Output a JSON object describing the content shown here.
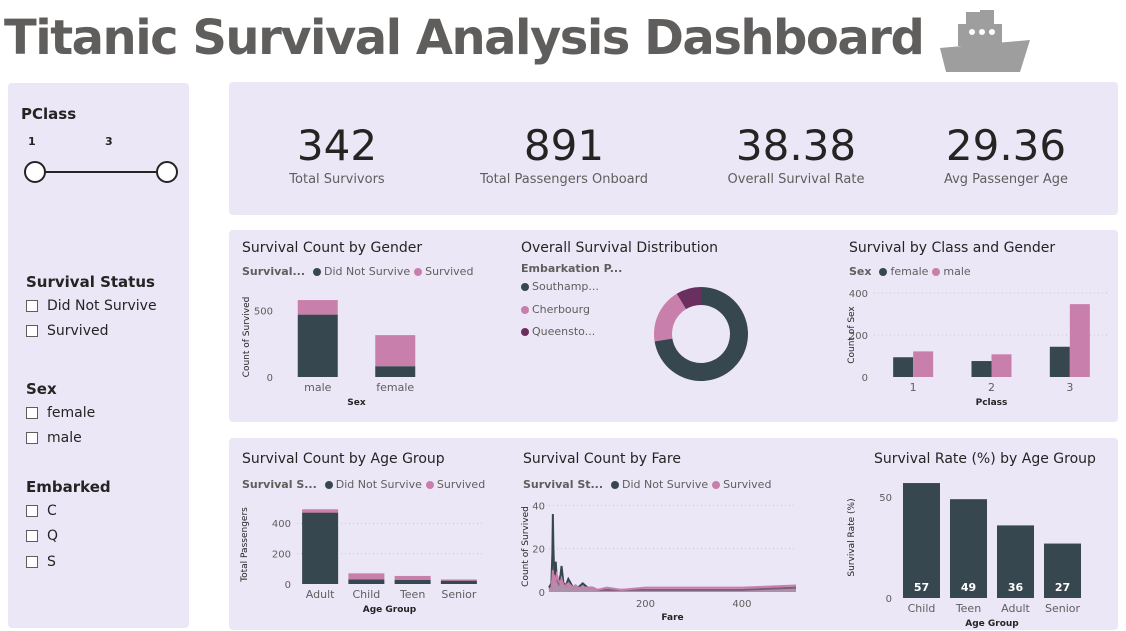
{
  "title": "Titanic Survival Analysis Dashboard",
  "colors": {
    "did_not_survive": "#37474f",
    "survived": "#c97fab",
    "queenstown": "#6b2f5f",
    "panel": "#ebe7f7"
  },
  "filters": {
    "pclass": {
      "title": "PClass",
      "min_label": "1",
      "max_label": "3"
    },
    "survival_status": {
      "title": "Survival Status",
      "options": [
        "Did Not Survive",
        "Survived"
      ]
    },
    "sex": {
      "title": "Sex",
      "options": [
        "female",
        "male"
      ]
    },
    "embarked": {
      "title": "Embarked",
      "options": [
        "C",
        "Q",
        "S"
      ]
    }
  },
  "kpis": [
    {
      "value": "342",
      "label": "Total Survivors"
    },
    {
      "value": "891",
      "label": "Total Passengers Onboard"
    },
    {
      "value": "38.38",
      "label": "Overall Survival Rate"
    },
    {
      "value": "29.36",
      "label": "Avg Passenger Age"
    }
  ],
  "charts": {
    "gender": {
      "title": "Survival Count by Gender",
      "legend_title": "Survival...",
      "legend": [
        "Did Not Survive",
        "Survived"
      ],
      "ylabel": "Count of Survived",
      "xlabel": "Sex"
    },
    "distribution": {
      "title": "Overall Survival Distribution",
      "legend_title": "Embarkation P...",
      "legend": [
        "Southamp...",
        "Cherbourg",
        "Queensto..."
      ]
    },
    "class_gender": {
      "title": "Survival by Class and Gender",
      "legend_title": "Sex",
      "legend": [
        "female",
        "male"
      ],
      "ylabel": "Count of Sex",
      "xlabel": "Pclass"
    },
    "age_group": {
      "title": "Survival Count by Age Group",
      "legend_title": "Survival S...",
      "legend": [
        "Did Not Survive",
        "Survived"
      ],
      "ylabel": "Total Passengers",
      "xlabel": "Age Group"
    },
    "fare": {
      "title": "Survival Count by Fare",
      "legend_title": "Survival St...",
      "legend": [
        "Did Not Survive",
        "Survived"
      ],
      "ylabel": "Count of Survived",
      "xlabel": "Fare"
    },
    "rate": {
      "title": "Survival Rate (%) by Age Group",
      "ylabel": "Survival Rate (%)",
      "xlabel": "Age Group"
    }
  },
  "chart_data": [
    {
      "type": "bar",
      "title": "Survival Count by Gender",
      "categories": [
        "male",
        "female"
      ],
      "series": [
        {
          "name": "Did Not Survive",
          "values": [
            468,
            81
          ]
        },
        {
          "name": "Survived",
          "values": [
            109,
            233
          ]
        }
      ],
      "xlabel": "Sex",
      "ylabel": "Count of Survived",
      "ylim": [
        0,
        600
      ],
      "yticks": [
        0,
        500
      ],
      "stacked": true
    },
    {
      "type": "pie",
      "title": "Overall Survival Distribution",
      "categories": [
        "Southamp...",
        "Cherbourg",
        "Queensto..."
      ],
      "values": [
        646,
        168,
        77
      ]
    },
    {
      "type": "bar",
      "title": "Survival by Class and Gender",
      "categories": [
        "1",
        "2",
        "3"
      ],
      "series": [
        {
          "name": "female",
          "values": [
            94,
            76,
            144
          ]
        },
        {
          "name": "male",
          "values": [
            122,
            108,
            347
          ]
        }
      ],
      "xlabel": "Pclass",
      "ylabel": "Count of Sex",
      "ylim": [
        0,
        400
      ],
      "yticks": [
        0,
        200,
        400
      ]
    },
    {
      "type": "bar",
      "title": "Survival Count by Age Group",
      "categories": [
        "Adult",
        "Child",
        "Teen",
        "Senior"
      ],
      "series": [
        {
          "name": "Did Not Survive",
          "values": [
            470,
            30,
            28,
            22
          ]
        },
        {
          "name": "Survived",
          "values": [
            22,
            40,
            25,
            8
          ]
        }
      ],
      "xlabel": "Age Group",
      "ylabel": "Total Passengers",
      "ylim": [
        0,
        520
      ],
      "yticks": [
        0,
        200,
        400
      ],
      "stacked": true
    },
    {
      "type": "area",
      "title": "Survival Count by Fare",
      "x": [
        0,
        5,
        7,
        8,
        9,
        10,
        12,
        14,
        16,
        20,
        24,
        26,
        30,
        35,
        40,
        50,
        55,
        60,
        70,
        80,
        90,
        100,
        120,
        150,
        200,
        250,
        300,
        400,
        512
      ],
      "series": [
        {
          "name": "Did Not Survive",
          "values": [
            2,
            4,
            18,
            36,
            22,
            14,
            6,
            14,
            6,
            4,
            8,
            12,
            4,
            3,
            6,
            2,
            3,
            2,
            4,
            2,
            2,
            1,
            1,
            1,
            1,
            1,
            1,
            1,
            2
          ]
        },
        {
          "name": "Survived",
          "values": [
            1,
            2,
            6,
            10,
            6,
            8,
            4,
            6,
            8,
            5,
            4,
            6,
            3,
            3,
            4,
            2,
            3,
            2,
            2,
            2,
            2,
            1,
            2,
            1,
            2,
            2,
            2,
            2,
            3
          ]
        }
      ],
      "xlabel": "Fare",
      "ylabel": "Count of Survived",
      "xlim": [
        0,
        512
      ],
      "ylim": [
        0,
        42
      ],
      "xticks": [
        200,
        400
      ],
      "yticks": [
        0,
        20,
        40
      ]
    },
    {
      "type": "bar",
      "title": "Survival Rate (%) by Age Group",
      "categories": [
        "Child",
        "Teen",
        "Adult",
        "Senior"
      ],
      "values": [
        57,
        49,
        36,
        27
      ],
      "xlabel": "Age Group",
      "ylabel": "Survival Rate (%)",
      "ylim": [
        0,
        60
      ],
      "yticks": [
        0,
        50
      ]
    }
  ]
}
